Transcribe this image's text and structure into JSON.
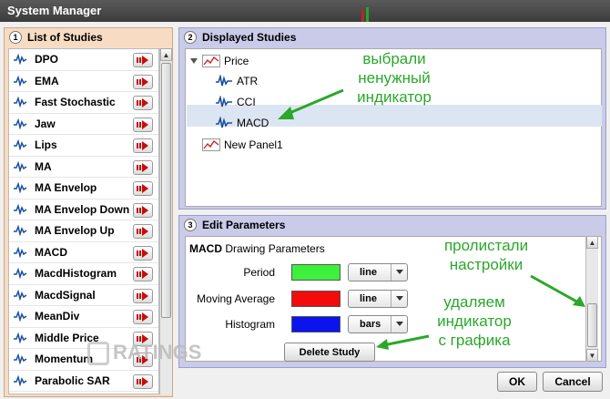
{
  "window": {
    "title": "System Manager"
  },
  "left_panel": {
    "number": "1",
    "title": "List of Studies",
    "items": [
      "DPO",
      "EMA",
      "Fast Stochastic",
      "Jaw",
      "Lips",
      "MA",
      "MA Envelop",
      "MA Envelop Down",
      "MA Envelop Up",
      "MACD",
      "MacdHistogram",
      "MacdSignal",
      "MeanDiv",
      "Middle Price",
      "Momentum",
      "Parabolic SAR"
    ]
  },
  "displayed_studies": {
    "number": "2",
    "title": "Displayed Studies",
    "root": "Price",
    "children": [
      "ATR",
      "CCI",
      "MACD"
    ],
    "selected": "MACD",
    "other_panels": [
      "New Panel1"
    ]
  },
  "edit_parameters": {
    "number": "3",
    "title": "Edit Parameters",
    "study_name": "MACD",
    "header_suffix": "Drawing Parameters",
    "rows": [
      {
        "label": "Period",
        "color": "#3cf03c",
        "style": "line"
      },
      {
        "label": "Moving Average",
        "color": "#f20c0c",
        "style": "line"
      },
      {
        "label": "Histogram",
        "color": "#0c14ee",
        "style": "bars"
      }
    ],
    "delete_label": "Delete Study"
  },
  "footer": {
    "ok_label": "OK",
    "cancel_label": "Cancel"
  },
  "annotations": {
    "selected_unneeded": [
      "выбрали",
      "ненужный",
      "индикатор"
    ],
    "scrolled_settings": [
      "пролистали",
      "настройки"
    ],
    "delete_indicator": [
      "удаляем",
      "индикатор",
      "с графика"
    ]
  },
  "watermark": {
    "text": "RATINGS"
  },
  "colors": {
    "accent_annotation": "#2aa82a",
    "left_panel_bg": "#f7dcc3",
    "right_panel_bg": "#c9cbe8",
    "selection": "#dce6f2"
  }
}
